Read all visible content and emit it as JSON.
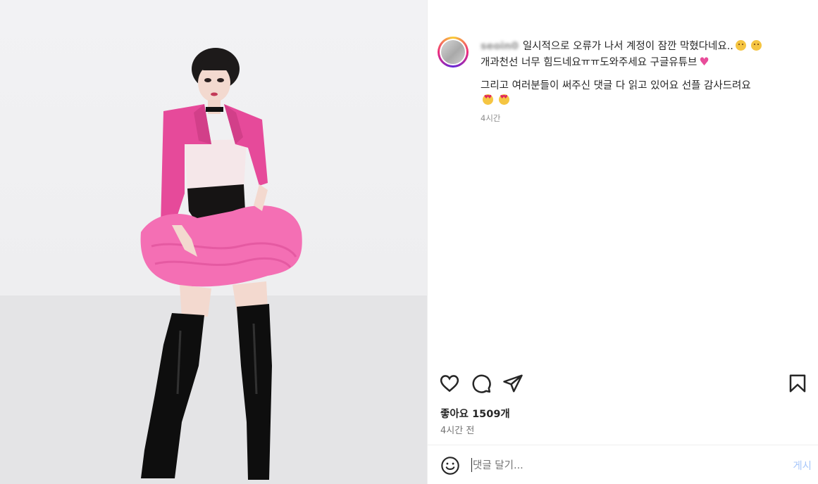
{
  "post": {
    "image_description_name": "photo",
    "comment": {
      "username": "seoin0",
      "line1": "일시적으로 오류가 나서 계정이 잠깐 막혔다네요..",
      "line2": "개과천선 너무 힘드네요ㅠㅠ도와주세요 구글유튜브",
      "line3": "그리고 여러분들이 써주신 댓글 다 읽고 있어요 선플 감사드려요",
      "time": "4시간"
    },
    "actions": {
      "like_icon": "heart-icon",
      "comment_icon": "comment-icon",
      "share_icon": "share-icon",
      "save_icon": "bookmark-icon"
    },
    "likes_text": "좋아요 1509개",
    "posted_time": "4시간 전",
    "composer": {
      "placeholder": "댓글 달기...",
      "post_label": "게시"
    },
    "colors": {
      "post_button": "#a8c7fa",
      "jacket": "#e64a9a",
      "skirt": "#f46fb4"
    }
  }
}
